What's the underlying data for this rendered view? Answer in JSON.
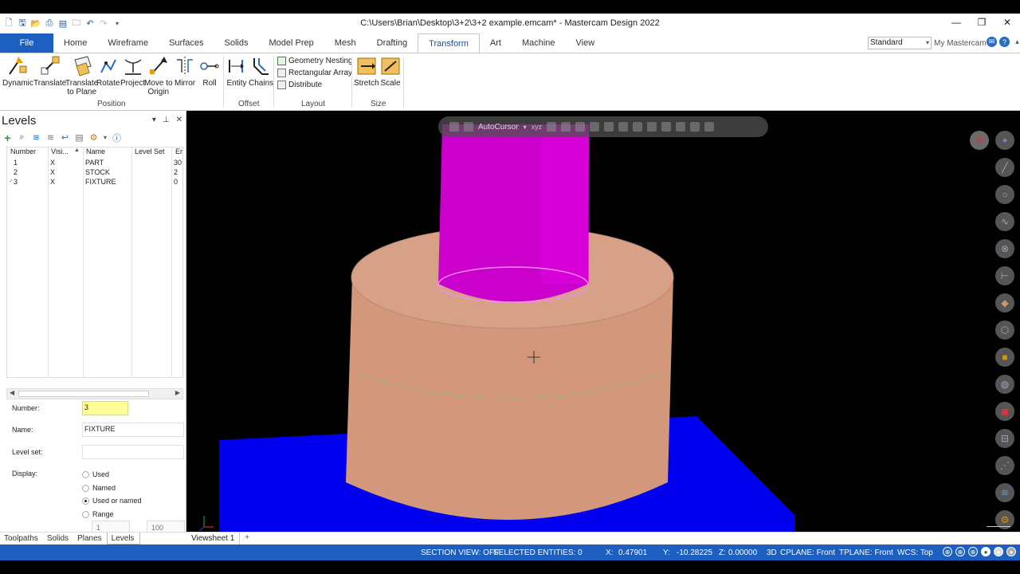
{
  "window": {
    "title": "C:\\Users\\Brian\\Desktop\\3+2\\3+2 example.emcam* - Mastercam Design 2022",
    "minimize": "—",
    "maximize": "❐",
    "close": "✕"
  },
  "ribbon_tabs": [
    {
      "label": "File"
    },
    {
      "label": "Home"
    },
    {
      "label": "Wireframe"
    },
    {
      "label": "Surfaces"
    },
    {
      "label": "Solids"
    },
    {
      "label": "Model Prep"
    },
    {
      "label": "Mesh"
    },
    {
      "label": "Drafting"
    },
    {
      "label": "Transform"
    },
    {
      "label": "Art"
    },
    {
      "label": "Machine"
    },
    {
      "label": "View"
    }
  ],
  "active_tab": "Transform",
  "workspace": {
    "selected": "Standard",
    "my_mastercam": "My Mastercam"
  },
  "ribbon": {
    "position": {
      "label": "Position",
      "buttons": {
        "dynamic": "Dynamic",
        "translate": "Translate",
        "translate_plane_1": "Translate",
        "translate_plane_2": "to Plane",
        "rotate": "Rotate",
        "project": "Project",
        "move_origin_1": "Move to",
        "move_origin_2": "Origin",
        "mirror": "Mirror",
        "roll": "Roll"
      }
    },
    "offset": {
      "label": "Offset",
      "entity": "Entity",
      "chains": "Chains"
    },
    "layout": {
      "label": "Layout",
      "geometry_nesting": "Geometry Nesting",
      "rectangular_array": "Rectangular Array",
      "distribute": "Distribute"
    },
    "size": {
      "label": "Size",
      "stretch": "Stretch",
      "scale": "Scale"
    }
  },
  "levels_panel": {
    "title": "Levels",
    "columns": [
      "Number",
      "Visi...",
      "Name",
      "Level Set",
      "Er"
    ],
    "rows": [
      {
        "number": "1",
        "visible": "X",
        "name": "PART",
        "level_set": "",
        "entities": "30"
      },
      {
        "number": "2",
        "visible": "X",
        "name": "STOCK",
        "level_set": "",
        "entities": "2"
      },
      {
        "number": "3",
        "visible": "X",
        "name": "FIXTURE",
        "level_set": "",
        "entities": "0"
      }
    ],
    "form": {
      "number_label": "Number:",
      "number_value": "3",
      "name_label": "Name:",
      "name_value": "FIXTURE",
      "level_set_label": "Level set:",
      "level_set_value": "",
      "display_label": "Display:",
      "display_options": [
        "Used",
        "Named",
        "Used or named",
        "Range"
      ],
      "display_selected": "Used or named",
      "range_from": "1",
      "range_to": "100"
    }
  },
  "bottom_tabs": [
    "Toolpaths",
    "Solids",
    "Planes",
    "Levels"
  ],
  "active_bottom_tab": "Levels",
  "viewsheet": {
    "label": "Viewsheet 1",
    "add": "+"
  },
  "viewport_toolbar": {
    "autocursor": "AutoCursor",
    "xyz": "xyz"
  },
  "status": {
    "section_view": "SECTION VIEW: OFF",
    "selected": "SELECTED ENTITIES: 0",
    "x_label": "X:",
    "x_value": "0.47901",
    "y_label": "Y:",
    "y_value": "-10.28225",
    "z_label": "Z:",
    "z_value": "0.00000",
    "mode": "3D",
    "cplane": "CPLANE: Front",
    "tplane": "TPLANE: Front",
    "wcs": "WCS: Top"
  },
  "colors": {
    "accent": "#1d5fbf",
    "part": "#cc00cc",
    "stock": "#d3987b",
    "fixture": "#0000ee",
    "viewport_bg": "#000000"
  }
}
